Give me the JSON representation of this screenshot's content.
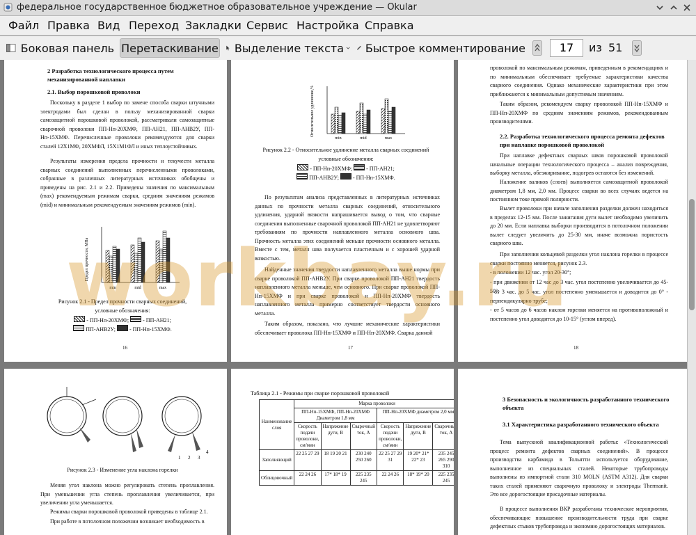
{
  "window": {
    "title": "федеральное государственное бюджетное образовательное учреждение — Okular"
  },
  "menu": [
    "Файл",
    "Правка",
    "Вид",
    "Переход",
    "Закладки",
    "Сервис",
    "Настройка",
    "Справка"
  ],
  "toolbar": {
    "sidebar_label": "Боковая панель",
    "drag_label": "Перетаскивание",
    "select_text_label": "Выделение текста",
    "quick_comment_label": "Быстрое комментирование",
    "page_current": "17",
    "page_of": "из",
    "page_total": "51"
  },
  "watermark": "workbay.ru",
  "pages": {
    "p16": {
      "heading": "2 Разработка технологического процесса путем механизированной наплавки",
      "subheading": "2.1. Выбор порошковой проволоки",
      "para1": "Поскольку в разделе 1 выбор по замене способа сварки штучными электродами был сделан в пользу механизированной сварки самозащитной порошковой проволокой, рассматривали самозащитные сварочной проволоки ПП-Нп-20ХМФ, ПП-АН21, ПП-АНВ2У, ПП-Нп-15ХМФ. Перечисленные проволоки рекомендуются для сварки сталей 12Х1МФ, 20ХМФЛ, 15Х1М1ФЛ и иных теплоустойчивых.",
      "para2": "Результаты измерения предела прочности и текучести металла сварных соединений выполненных перечисленными проволоками, собранные в различных литературных источниках обобщены и приведены на рис. 2.1 и 2.2. Приведены значения по максимальным (max) рекомендуемым режимам сварки, средним значениям режимов (mid) и минимальным рекомендуемым значениям режимов (min).",
      "chart_ylabel": "Предел прочности, МПа",
      "chart_cats": [
        "min",
        "mid",
        "max"
      ],
      "caption": "Рисунок 2.1 - Предел прочности сварных соединений,",
      "caption2": "условные обозначения:",
      "legend1": "- ПП-Нп-20ХМФ;",
      "legend2": "- ПП-АН21;",
      "legend3": "ПП-АНВ2У;",
      "legend4": "- ПП-Нп-15ХМФ.",
      "num": "16"
    },
    "p17": {
      "chart_ylabel": "Относительное удлинение,%",
      "chart_cats": [
        "min",
        "mid",
        "max"
      ],
      "caption": "Рисунок 2.2 - Относительное удлинение металла сварных соединений",
      "caption2": "условные обозначения:",
      "legend1": "- ПП-Нп-20ХМФ;",
      "legend2": "- ПП-АН21;",
      "legend3": "ПП-АНВ2У;",
      "legend4": "- ПП-Нп-15ХМФ.",
      "para1": "По результатам анализа представленных в литературных источниках данных по прочности металла сварных соединений, относительного удлинения, ударной вязкости напрашивается вывод о том, что сварные соединения выполненные сварочной проволокой ПП-АН21 не удовлетворяют требованиям по прочности наплавленного металла основного шва. Прочность металла этих соединений меньше прочности основного металла. Вместе с тем, металл шва получается пластичным и с хорошей ударной вязкостью.",
      "para2": "Найденные значения твердости наплавленного металла выше нормы при сварке проволокой ПП-АНВ2У. При сварке проволокой ПП-АН21 твердость наплавленного металла меньше, чем основного. При сварке проволокой ПП-Нп-15ХМФ и при сварке проволокой и ПП-Нп-20ХМФ твердость наплавленного металла примерно соответствует твердости основного металла.",
      "para3": "Таким образом, показано, что лучшие механические характеристики обеспечивает проволока ПП-Нп-15ХМФ и ПП-Нп-20ХМФ. Сварка данной",
      "num": "17"
    },
    "p18": {
      "para1": "проволокой по максимальным режимам, приведенным в рекомендациях и по минимальным обеспечивает требуемые характеристики качества сварного соединения. Однако механические характеристики при этом приближаются к минимальным допустимым значениям.",
      "para2": "Таким образом, рекомендуем сварку проволокой ПП-Нп-15ХМФ и ПП-Нп-20ХМФ по средним значениям режимов, рекомендованным производителями.",
      "heading": "2.2. Разработка технологического процесса ремонта дефектов при наплавке порошковой проволокой",
      "para3": "При наплавке дефектных сварных швов порошковой проволокой начальные операции технологического процесса – анализ повреждения, выборку металла, обезжиривание, подогрев остаются без изменений.",
      "para4": "Наложение валиков (слоев) выполняется самозащитной проволокой диаметром 1,8 мм, 2,0 мм. Процесс сварки во всех случаях ведется на постоянном токе прямой полярности.",
      "para5": "Вылет проволоки при начале заполнения разделки должен находиться в пределах 12-15 мм. После зажигания дуги вылет необходимо увеличить до 20 мм. Если наплавка выборки производится в потолочном положении вылет следует увеличить до 25-30 мм, иначе возможна пористость сварного шва.",
      "para6": "При заполнении кольцевой разделки угол наклона горелки в процессе сварки постоянно меняется, рисунок 2.3.",
      "item1": "- в положении 12 час. угол 20-30°;",
      "item2": "- при движении от 12 час до 3 час. угол постепенно увеличивается до 45-50°;",
      "item3": "- от 3 час. до 5 час. угол постепенно уменьшается и доводится до 0° - перпендикулярно трубе;",
      "item4": "- от 5 часов до 6 часов наклон горелки меняется на противоположный и постепенно угол доводится до 10-15° (углом вперед).",
      "num": "18"
    },
    "p19": {
      "caption": "Рисунок 2.3 - Изменение угла наклона горелки",
      "para1": "Меняя угол наклона можно регулировать степень проплавления. При уменьшении угла степень проплавления увеличивается, при увеличении угла уменьшается.",
      "para2": "Режимы сварки порошковой проволокой приведены в таблице 2.1.",
      "para3": "При работе в потолочном положении возникает необходимость в",
      "labels": [
        "1",
        "2",
        "3",
        "4"
      ]
    },
    "p20": {
      "table_title": "Таблица 2.1 - Режимы при сварке порошковой проволокой",
      "col_layer": "Наименование слоя",
      "col_brand": "Марка проволоки",
      "group1": "ПП-Нп-15ХМФ, ПП-Нп-20ХМФ Диаметром 1,8 мм",
      "group2": "ПП-Нп-20ХМФ диаметром 2,0 мм",
      "sub_speed": "Скорость подачи проволоки, см/мин",
      "sub_voltage": "Напряжение дуги, В",
      "sub_current": "Сварочный ток, А",
      "row1_name": "Заполняющий",
      "row1_g1_speed": "22 25 27 29",
      "row1_g1_volt": "18 19 20 21",
      "row1_g1_cur": "230 240 250 260",
      "row1_g2_speed": "22 25 27 29 31",
      "row1_g2_volt": "19 20* 21* 22* 23",
      "row1_g2_cur": "235 245 265 290 310",
      "row2_name": "Облицовочный",
      "row2_g1_speed": "22 24 26",
      "row2_g1_volt": "17* 18* 19",
      "row2_g1_cur": "225 235 245",
      "row2_g2_speed": "22 24 26",
      "row2_g2_volt": "18* 19* 20",
      "row2_g2_cur": "225 235 245"
    },
    "p21": {
      "heading": "3 Безопасность и экологичность разработанного технического объекта",
      "subheading": "3.1 Характеристика разработанного технического объекта",
      "para1": "Тема выпускной квалификационной работы: «Технологический процесс ремонта дефектов сварных соединений». В процессе производства карбамида в Тольятти используется оборудование, выполненное из специальных сталей. Некоторые трубопроводы выполнены из импортной стали 310 MOLN (ASTM A312). Для сварки таких сталей применяют сварочную проволоку и электроды Thermanit. Это все дорогостоящие присадочные материалы.",
      "para2": "В процессе выполнения ВКР разработаны технические мероприятия, обеспечивающие повышение производительности труда при сварке дефектных стыков трубопровода и экономию дорогостоящих материалов."
    }
  }
}
